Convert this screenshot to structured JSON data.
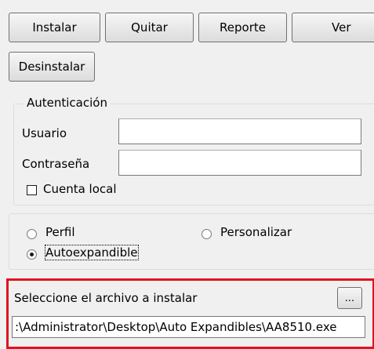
{
  "toolbar": {
    "install_label": "Instalar",
    "remove_label": "Quitar",
    "report_label": "Reporte",
    "view_label": "Ver",
    "uninstall_label": "Desinstalar"
  },
  "auth": {
    "legend": "Autenticación",
    "user_label": "Usuario",
    "user_value": "",
    "password_label": "Contraseña",
    "password_value": "",
    "local_account_label": "Cuenta local",
    "local_account_checked": false
  },
  "options": {
    "profile_label": "Perfil",
    "customize_label": "Personalizar",
    "autoexpand_label": "Autoexpandible",
    "selected": "Autoexpandible"
  },
  "file": {
    "prompt_label": "Seleccione el archivo a instalar",
    "browse_label": "...",
    "path_value": ":\\Administrator\\Desktop\\Auto Expandibles\\AA8510.exe"
  },
  "colors": {
    "highlight_frame": "#e0141e",
    "window_bg": "#f0f0f0"
  }
}
